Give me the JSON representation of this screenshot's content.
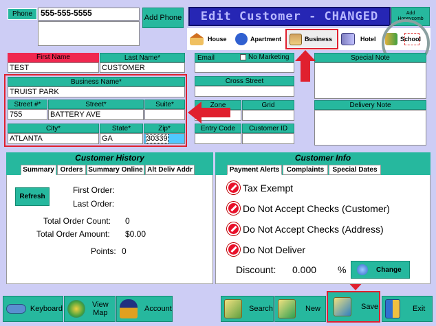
{
  "phone": {
    "label": "Phone",
    "value": "555-555-5555",
    "add_label": "Add Phone"
  },
  "title": {
    "text": "Edit Customer - CHANGED"
  },
  "add_honeycomb": {
    "line1": "Add",
    "line2": "Honeycomb"
  },
  "location_types": [
    {
      "label": "House",
      "icon": "house-icon"
    },
    {
      "label": "Apartment",
      "icon": "apartment-icon"
    },
    {
      "label": "Business",
      "icon": "business-icon"
    },
    {
      "label": "Hotel",
      "icon": "hotel-icon"
    },
    {
      "label": "School",
      "icon": "school-icon"
    }
  ],
  "name": {
    "first_label": "First Name",
    "first_value": "TEST",
    "last_label": "Last Name*",
    "last_value": "CUSTOMER"
  },
  "email": {
    "label": "Email",
    "value": ""
  },
  "no_marketing": {
    "label": "No Marketing"
  },
  "special_note": {
    "label": "Special Note"
  },
  "business": {
    "label": "Business Name*",
    "value": "TRUIST PARK"
  },
  "street_no": {
    "label": "Street #*",
    "value": "755"
  },
  "street": {
    "label": "Street*",
    "value": "BATTERY AVE"
  },
  "suite": {
    "label": "Suite*",
    "value": ""
  },
  "city": {
    "label": "City*",
    "value": "ATLANTA"
  },
  "state": {
    "label": "State*",
    "value": "GA"
  },
  "zip": {
    "label": "Zip*",
    "value": "30339"
  },
  "cross_street": {
    "label": "Cross Street"
  },
  "zone": {
    "label": "Zone"
  },
  "grid": {
    "label": "Grid"
  },
  "entry_code": {
    "label": "Entry Code"
  },
  "customer_id": {
    "label": "Customer ID"
  },
  "delivery_note": {
    "label": "Delivery Note"
  },
  "history": {
    "title": "Customer History",
    "tabs": [
      "Summary",
      "Orders",
      "Summary Online",
      "Alt Deliv Addr"
    ],
    "refresh": "Refresh",
    "first_order": "First Order:",
    "last_order": "Last Order:",
    "count_label": "Total Order Count:",
    "count_value": "0",
    "amount_label": "Total Order Amount:",
    "amount_value": "$0.00",
    "points_label": "Points:",
    "points_value": "0"
  },
  "info": {
    "title": "Customer Info",
    "tabs": [
      "Payment Alerts",
      "Complaints",
      "Special Dates"
    ],
    "alerts": [
      "Tax Exempt",
      "Do Not Accept Checks (Customer)",
      "Do Not Accept Checks (Address)",
      "Do Not Deliver"
    ],
    "discount_label": "Discount:",
    "discount_value": "0.000",
    "percent": "%",
    "change": "Change"
  },
  "bottom": {
    "keyboard": "Keyboard",
    "view_map_1": "View",
    "view_map_2": "Map",
    "account": "Account",
    "search": "Search",
    "new": "New",
    "save": "Save",
    "exit": "Exit"
  }
}
